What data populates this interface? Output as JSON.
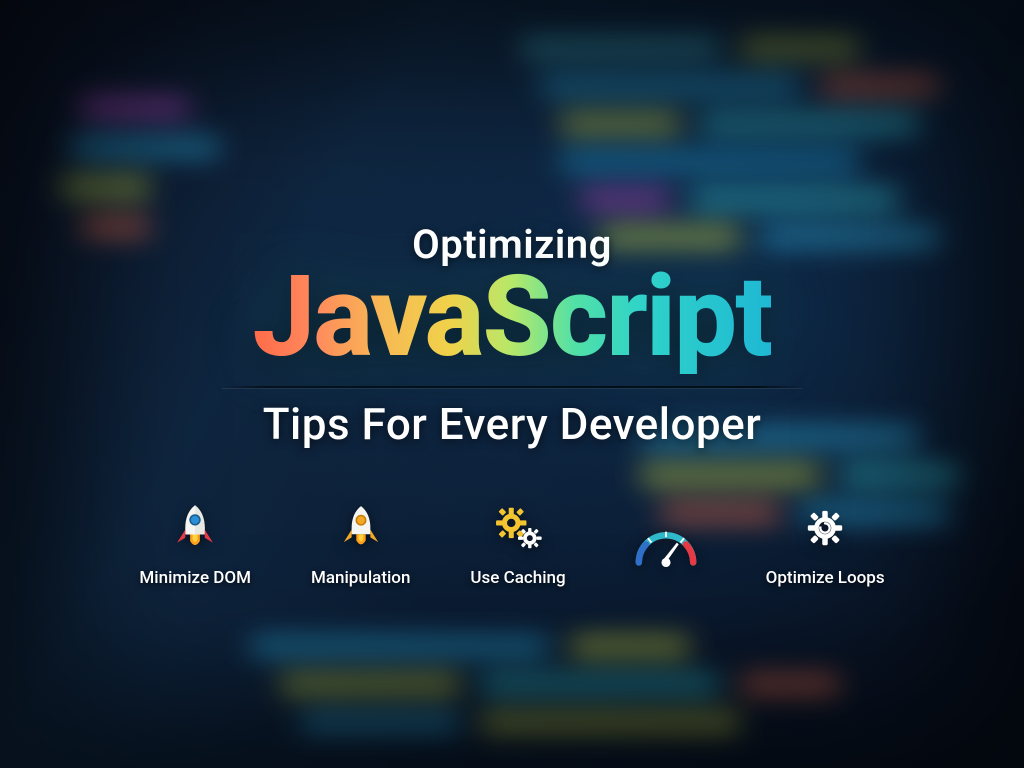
{
  "supertitle": "Optimizing",
  "title": "JavaScript",
  "subtitle": "Tips For Every Developer",
  "tips": [
    {
      "label": "Minimize DOM",
      "icon": "rocket-blue-icon"
    },
    {
      "label": "Manipulation",
      "icon": "rocket-yellow-icon"
    },
    {
      "label": "Use Caching",
      "icon": "gears-icon"
    },
    {
      "label": "",
      "icon": "gauge-icon"
    },
    {
      "label": "Optimize Loops",
      "icon": "gear-loop-icon"
    }
  ],
  "colors": {
    "gradient_start": "#ff6b4a",
    "gradient_end": "#1fb8d4",
    "caption": "#ffffff"
  }
}
